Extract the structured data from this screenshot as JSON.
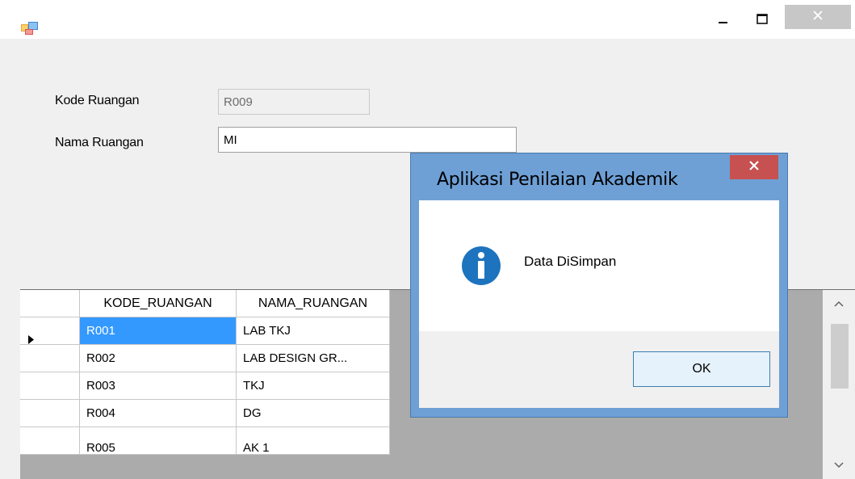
{
  "window": {
    "title": "",
    "controls": {
      "minimize": "minimize-icon",
      "maximize": "maximize-icon",
      "close": "close-icon"
    }
  },
  "form": {
    "kode_label": "Kode Ruangan",
    "kode_value": "R009",
    "nama_label": "Nama Ruangan",
    "nama_value": "MI"
  },
  "grid": {
    "columns": [
      "KODE_RUANGAN",
      "NAMA_RUANGAN"
    ],
    "rows": [
      {
        "kode": "R001",
        "nama": "LAB TKJ",
        "selected": true
      },
      {
        "kode": "R002",
        "nama": "LAB DESIGN GR..."
      },
      {
        "kode": "R003",
        "nama": "TKJ"
      },
      {
        "kode": "R004",
        "nama": "DG"
      },
      {
        "kode": "R005",
        "nama": "AK 1"
      }
    ],
    "selection_color": "#3399ff"
  },
  "dialog": {
    "title": "Aplikasi Penilaian Akademik",
    "message": "Data DiSimpan",
    "ok_label": "OK",
    "icon": "info-icon",
    "accent": "#1e73be"
  }
}
